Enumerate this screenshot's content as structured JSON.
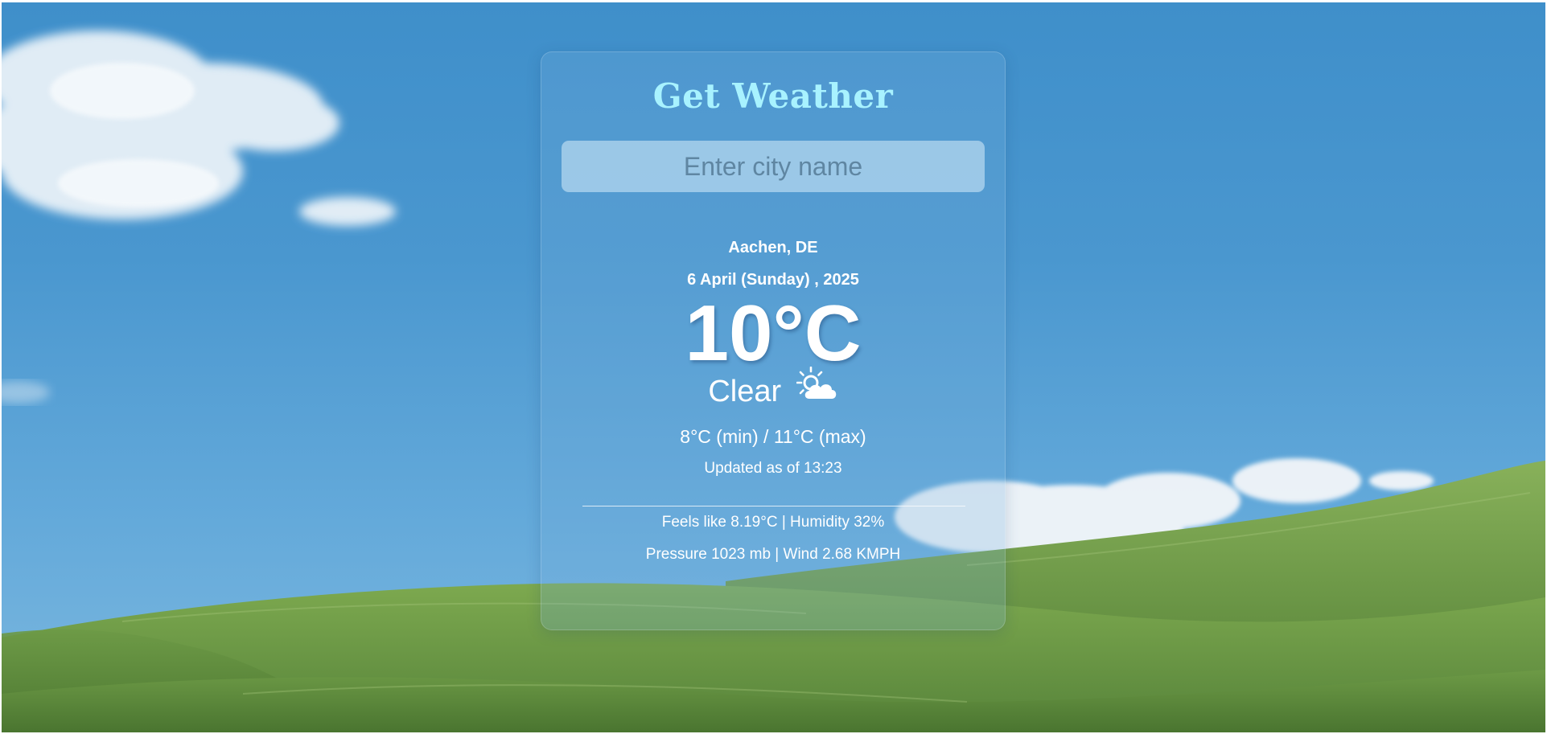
{
  "app": {
    "title": "Get Weather"
  },
  "search": {
    "placeholder": "Enter city name",
    "value": ""
  },
  "weather": {
    "location": "Aachen, DE",
    "date": "6 April (Sunday) , 2025",
    "temperature": "10°C",
    "condition": "Clear",
    "condition_icon": "sun-behind-cloud-icon",
    "min_max": "8°C (min) / 11°C (max)",
    "updated": "Updated as of 13:23",
    "details_line1": "Feels like 8.19°C | Humidity 32%",
    "details_line2": "Pressure 1023 mb | Wind 2.68 KMPH"
  },
  "colors": {
    "sky": "#4a97cf",
    "title": "#a8f2ff",
    "grass": "#6f9a44",
    "text": "#ffffff"
  }
}
